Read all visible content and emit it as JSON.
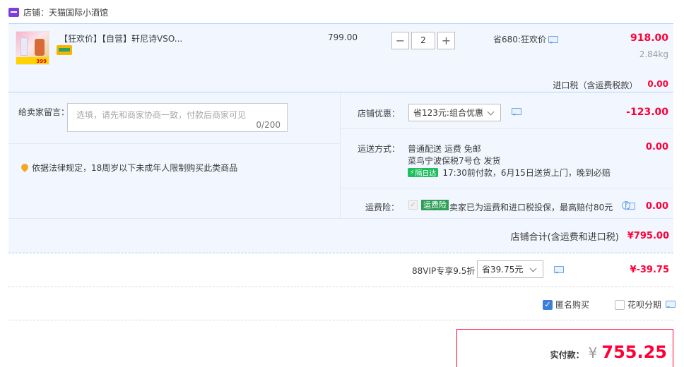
{
  "shop": {
    "label": "店铺：",
    "name": "天猫国际小酒馆"
  },
  "item": {
    "title": "【狂欢价】【自营】轩尼诗VSO...",
    "unit_price": "799.00",
    "quantity": "2",
    "promo": "省680:狂欢价",
    "total": "918.00",
    "weight": "2.84kg",
    "thumb_caption": "399"
  },
  "import_tax": {
    "label": "进口税（含运费税款）",
    "value": "0.00"
  },
  "message": {
    "label": "给卖家留言：",
    "placeholder": "选填，请先和商家协商一致，付款后商家可见",
    "counter": "0/200"
  },
  "notice": "依据法律规定，18周岁以下未成年人限制购买此类商品",
  "shop_discount": {
    "label": "店铺优惠：",
    "selected": "省123元:组合优惠",
    "value": "-123.00"
  },
  "shipping": {
    "label": "运送方式：",
    "line1": "普通配送 运费 免邮",
    "line2": "菜鸟宁波保税7号仓   发货",
    "badge": "隔日达",
    "line3": "17:30前付款，6月15日送货上门，晚到必赔",
    "value": "0.00"
  },
  "insurance": {
    "label": "运费险：",
    "tag": "运费险",
    "text": "卖家已为运费和进口税投保，最高赔付80元",
    "value": "0.00"
  },
  "shop_total": {
    "label": "店铺合计(含运费和进口税)",
    "value": "¥795.00"
  },
  "vip": {
    "label": "88VIP专享9.5折",
    "selected": "省39.75元",
    "value": "¥-39.75"
  },
  "options": {
    "anonymous": "匿名购买",
    "huabei": "花呗分期"
  },
  "payment": {
    "label": "实付款：",
    "currency": "¥",
    "amount": "755.25"
  },
  "colors": {
    "accent": "#ff0036",
    "panel": "#f2f7ff",
    "check": "#3d7fd8"
  }
}
